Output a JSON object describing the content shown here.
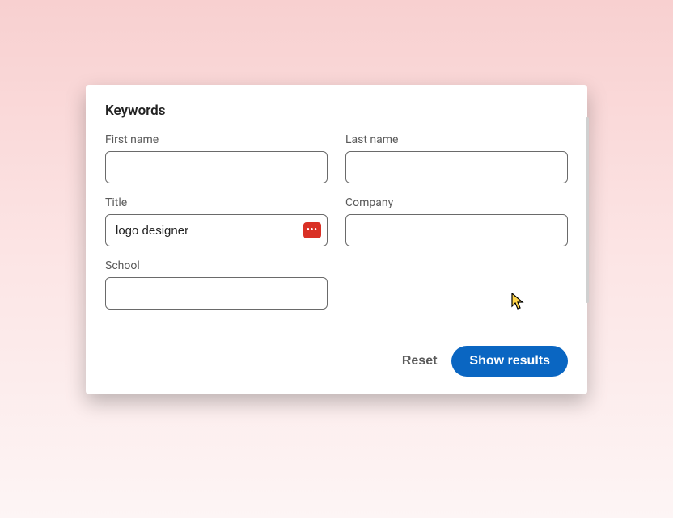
{
  "section_title": "Keywords",
  "fields": {
    "first_name": {
      "label": "First name",
      "value": ""
    },
    "last_name": {
      "label": "Last name",
      "value": ""
    },
    "title": {
      "label": "Title",
      "value": "logo designer"
    },
    "company": {
      "label": "Company",
      "value": ""
    },
    "school": {
      "label": "School",
      "value": ""
    }
  },
  "footer": {
    "reset_label": "Reset",
    "submit_label": "Show results"
  }
}
